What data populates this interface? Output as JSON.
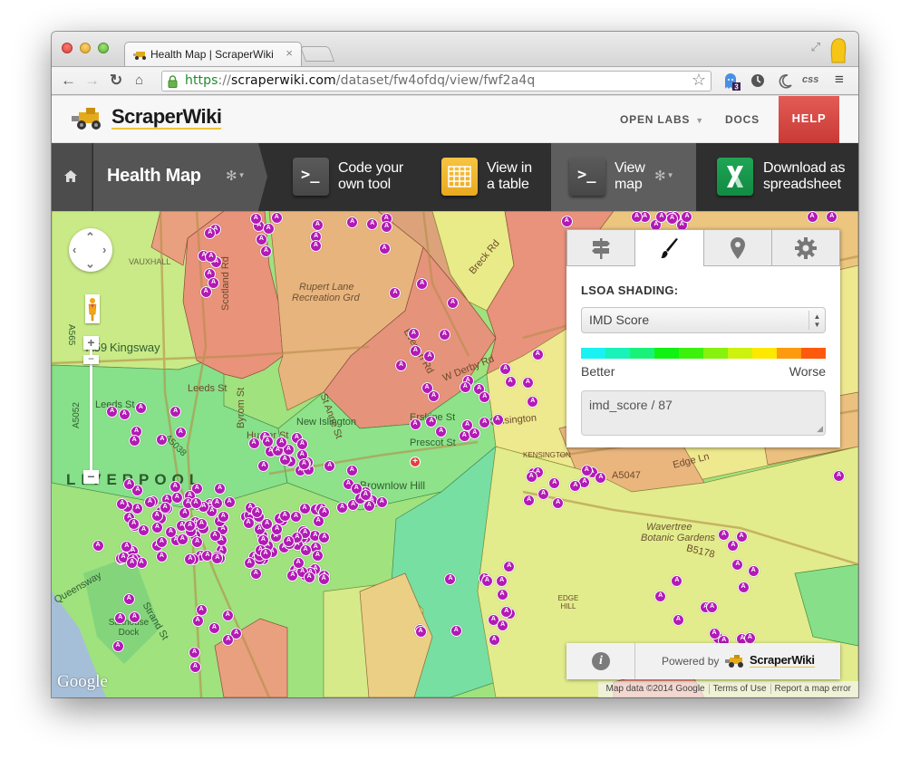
{
  "browser": {
    "tab_title": "Health Map | ScraperWiki",
    "url": {
      "scheme": "https",
      "separator": "://",
      "host": "scraperwiki.com",
      "path": "/dataset/fw4ofdq/view/fwf2a4q"
    },
    "extension_badge": "3",
    "extension_css_label": "css"
  },
  "site_header": {
    "brand": "ScraperWiki",
    "nav": [
      {
        "label": "OPEN LABS",
        "has_dropdown": true
      },
      {
        "label": "DOCS",
        "has_dropdown": false
      }
    ],
    "help_label": "HELP",
    "help_color": "#d9463f"
  },
  "dataset_toolbar": {
    "title": "Health Map",
    "tools": [
      {
        "label_line1": "Code your",
        "label_line2": "own tool",
        "icon": "terminal-icon",
        "active": false
      },
      {
        "label_line1": "View in",
        "label_line2": "a table",
        "icon": "table-icon",
        "active": false
      },
      {
        "label_line1": "View",
        "label_line2": "map",
        "icon": "terminal-icon",
        "active": true
      },
      {
        "label_line1": "Download as",
        "label_line2": "spreadsheet",
        "icon": "excel-icon",
        "active": false
      }
    ]
  },
  "map": {
    "labels": {
      "kingsway": "Kingsway",
      "vauxhall": "VAUXHALL",
      "liverpool": "LIVERPOOL",
      "leeds_st": "Leeds St",
      "leeds_st2": "Leeds St",
      "scotland_rd": "Scotland Rd",
      "byrom_st": "Byrom St",
      "st_anne_st": "St Anne St",
      "hunter_st": "Hunter St",
      "new_islington": "New Islington",
      "erskine_st": "Erskine St",
      "prescot_st": "Prescot St",
      "kensington_road": "Kensington",
      "kensington_area": "KENSINGTON",
      "rupert_lane": "Rupert Lane",
      "rupert_lane2": "Recreation Grd",
      "everton_rd": "Everton Rd",
      "w_derby_rd": "W Derby Rd",
      "breck_rd": "Breck Rd",
      "brownlow_hill": "Brownlow Hill",
      "edge_ln": "Edge Ln",
      "a5047": "A5047",
      "wavertree": "Wavertree",
      "botanic": "Botanic Gardens",
      "b5178": "B5178",
      "edge_hill": "EDGE HILL",
      "saltouse_dock": "Salthouse Dock",
      "strand_st": "Strand St",
      "queensway": "Queensway",
      "a59": "A59",
      "a565": "A565",
      "a5052": "A5052",
      "a5038": "A5038"
    },
    "google_logo": "Google",
    "attribution": {
      "map_data": "Map data ©2014 Google",
      "terms": "Terms of Use",
      "report": "Report a map error"
    },
    "zoom_in": "+",
    "zoom_out": "−",
    "marker_letter": "A",
    "hospital_symbol": "+"
  },
  "settings_panel": {
    "tabs": [
      {
        "name": "signpost",
        "active": false
      },
      {
        "name": "brush",
        "active": true
      },
      {
        "name": "location-pin",
        "active": false
      },
      {
        "name": "gear",
        "active": false
      }
    ],
    "heading": "LSOA SHADING:",
    "select_value": "IMD Score",
    "scale_colors": [
      "#19f2f2",
      "#19f2b8",
      "#19f27a",
      "#12f212",
      "#3cf20d",
      "#86f20d",
      "#ccf20d",
      "#fde800",
      "#fd9a0d",
      "#fd5a0d"
    ],
    "scale_low_label": "Better",
    "scale_high_label": "Worse",
    "expression": "imd_score / 87"
  },
  "footer_panel": {
    "info_symbol": "i",
    "powered_by": "Powered by",
    "brand": "ScraperWiki"
  }
}
